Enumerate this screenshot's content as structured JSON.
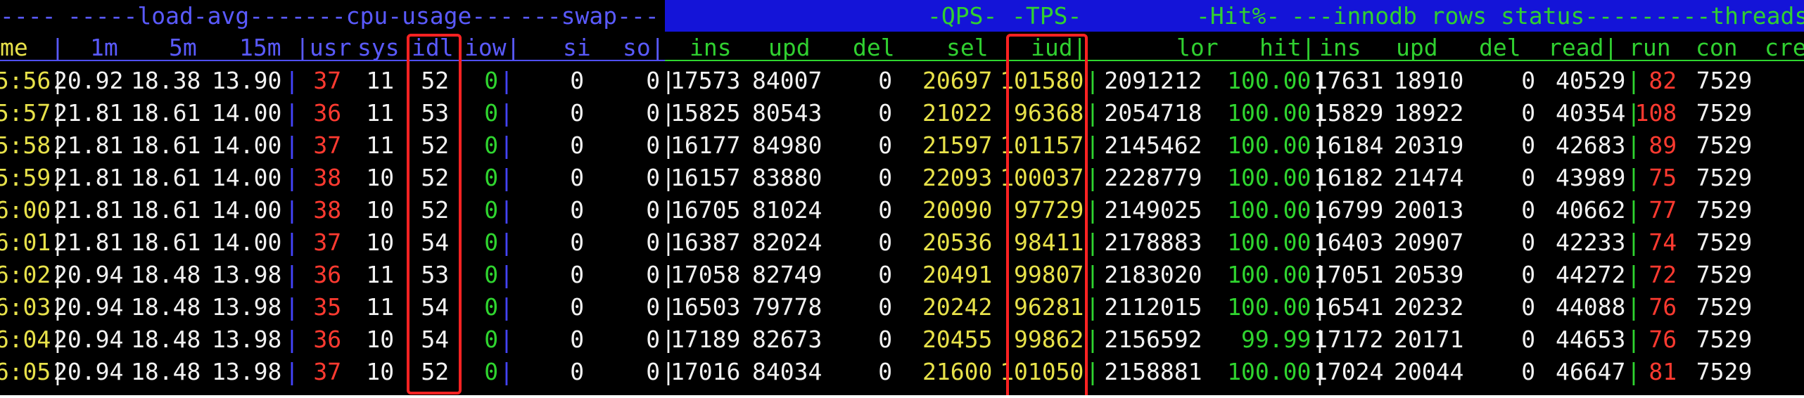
{
  "section_titles": {
    "timer": "----",
    "load_avg": "-----load-avg----",
    "cpu_usage": "---cpu-usage---",
    "swap": "---swap---",
    "qps": "-QPS-",
    "tps": "-TPS-",
    "hit": "-Hit%-",
    "innodb": "---innodb rows status---",
    "threads": "------threads-"
  },
  "columns": [
    "me",
    "|",
    "1m",
    "5m",
    "15m",
    "|usr",
    "sys",
    "idl",
    "iow|",
    "si",
    "so|",
    "ins",
    "upd",
    "del",
    "sel",
    "iud|",
    "lor",
    "hit|",
    "ins",
    "upd",
    "del",
    "read|",
    "run",
    "con",
    "cre"
  ],
  "rows": [
    {
      "time": "5:56",
      "l1": "20.92",
      "l5": "18.38",
      "l15": "13.90",
      "usr": "37",
      "sys": "11",
      "idl": "52",
      "iow": "0",
      "si": "0",
      "so": "0",
      "ins": "17573",
      "upd": "84007",
      "del": "0",
      "sel": "20697",
      "iud": "101580",
      "lor": "2091212",
      "hit": "100.00",
      "iins": "17631",
      "iupd": "18910",
      "idel": "0",
      "iread": "40529",
      "run": "82",
      "con": "7529"
    },
    {
      "time": "5:57",
      "l1": "21.81",
      "l5": "18.61",
      "l15": "14.00",
      "usr": "36",
      "sys": "11",
      "idl": "53",
      "iow": "0",
      "si": "0",
      "so": "0",
      "ins": "15825",
      "upd": "80543",
      "del": "0",
      "sel": "21022",
      "iud": "96368",
      "lor": "2054718",
      "hit": "100.00",
      "iins": "15829",
      "iupd": "18922",
      "idel": "0",
      "iread": "40354",
      "run": "108",
      "con": "7529"
    },
    {
      "time": "5:58",
      "l1": "21.81",
      "l5": "18.61",
      "l15": "14.00",
      "usr": "37",
      "sys": "11",
      "idl": "52",
      "iow": "0",
      "si": "0",
      "so": "0",
      "ins": "16177",
      "upd": "84980",
      "del": "0",
      "sel": "21597",
      "iud": "101157",
      "lor": "2145462",
      "hit": "100.00",
      "iins": "16184",
      "iupd": "20319",
      "idel": "0",
      "iread": "42683",
      "run": "89",
      "con": "7529"
    },
    {
      "time": "5:59",
      "l1": "21.81",
      "l5": "18.61",
      "l15": "14.00",
      "usr": "38",
      "sys": "10",
      "idl": "52",
      "iow": "0",
      "si": "0",
      "so": "0",
      "ins": "16157",
      "upd": "83880",
      "del": "0",
      "sel": "22093",
      "iud": "100037",
      "lor": "2228779",
      "hit": "100.00",
      "iins": "16182",
      "iupd": "21474",
      "idel": "0",
      "iread": "43989",
      "run": "75",
      "con": "7529"
    },
    {
      "time": "6:00",
      "l1": "21.81",
      "l5": "18.61",
      "l15": "14.00",
      "usr": "38",
      "sys": "10",
      "idl": "52",
      "iow": "0",
      "si": "0",
      "so": "0",
      "ins": "16705",
      "upd": "81024",
      "del": "0",
      "sel": "20090",
      "iud": "97729",
      "lor": "2149025",
      "hit": "100.00",
      "iins": "16799",
      "iupd": "20013",
      "idel": "0",
      "iread": "40662",
      "run": "77",
      "con": "7529"
    },
    {
      "time": "6:01",
      "l1": "21.81",
      "l5": "18.61",
      "l15": "14.00",
      "usr": "37",
      "sys": "10",
      "idl": "54",
      "iow": "0",
      "si": "0",
      "so": "0",
      "ins": "16387",
      "upd": "82024",
      "del": "0",
      "sel": "20536",
      "iud": "98411",
      "lor": "2178883",
      "hit": "100.00",
      "iins": "16403",
      "iupd": "20907",
      "idel": "0",
      "iread": "42233",
      "run": "74",
      "con": "7529"
    },
    {
      "time": "6:02",
      "l1": "20.94",
      "l5": "18.48",
      "l15": "13.98",
      "usr": "36",
      "sys": "11",
      "idl": "53",
      "iow": "0",
      "si": "0",
      "so": "0",
      "ins": "17058",
      "upd": "82749",
      "del": "0",
      "sel": "20491",
      "iud": "99807",
      "lor": "2183020",
      "hit": "100.00",
      "iins": "17051",
      "iupd": "20539",
      "idel": "0",
      "iread": "44272",
      "run": "72",
      "con": "7529"
    },
    {
      "time": "6:03",
      "l1": "20.94",
      "l5": "18.48",
      "l15": "13.98",
      "usr": "35",
      "sys": "11",
      "idl": "54",
      "iow": "0",
      "si": "0",
      "so": "0",
      "ins": "16503",
      "upd": "79778",
      "del": "0",
      "sel": "20242",
      "iud": "96281",
      "lor": "2112015",
      "hit": "100.00",
      "iins": "16541",
      "iupd": "20232",
      "idel": "0",
      "iread": "44088",
      "run": "76",
      "con": "7529"
    },
    {
      "time": "6:04",
      "l1": "20.94",
      "l5": "18.48",
      "l15": "13.98",
      "usr": "36",
      "sys": "10",
      "idl": "54",
      "iow": "0",
      "si": "0",
      "so": "0",
      "ins": "17189",
      "upd": "82673",
      "del": "0",
      "sel": "20455",
      "iud": "99862",
      "lor": "2156592",
      "hit": "99.99",
      "iins": "17172",
      "iupd": "20171",
      "idel": "0",
      "iread": "44653",
      "run": "76",
      "con": "7529"
    },
    {
      "time": "6:05",
      "l1": "20.94",
      "l5": "18.48",
      "l15": "13.98",
      "usr": "37",
      "sys": "10",
      "idl": "52",
      "iow": "0",
      "si": "0",
      "so": "0",
      "ins": "17016",
      "upd": "84034",
      "del": "0",
      "sel": "21600",
      "iud": "101050",
      "lor": "2158881",
      "hit": "100.00",
      "iins": "17024",
      "iupd": "20044",
      "idel": "0",
      "iread": "46647",
      "run": "81",
      "con": "7529"
    }
  ],
  "colors": {
    "background": "#000000",
    "top_bar": "#1414d8",
    "time": "#e8e24a",
    "load": "#f2f2f2",
    "usr_cpu": "#ff3a30",
    "iow": "#2fd52f",
    "sel": "#e8e24a",
    "hit": "#2fd52f",
    "run": "#ff3a30",
    "annotation": "#ff2222"
  }
}
